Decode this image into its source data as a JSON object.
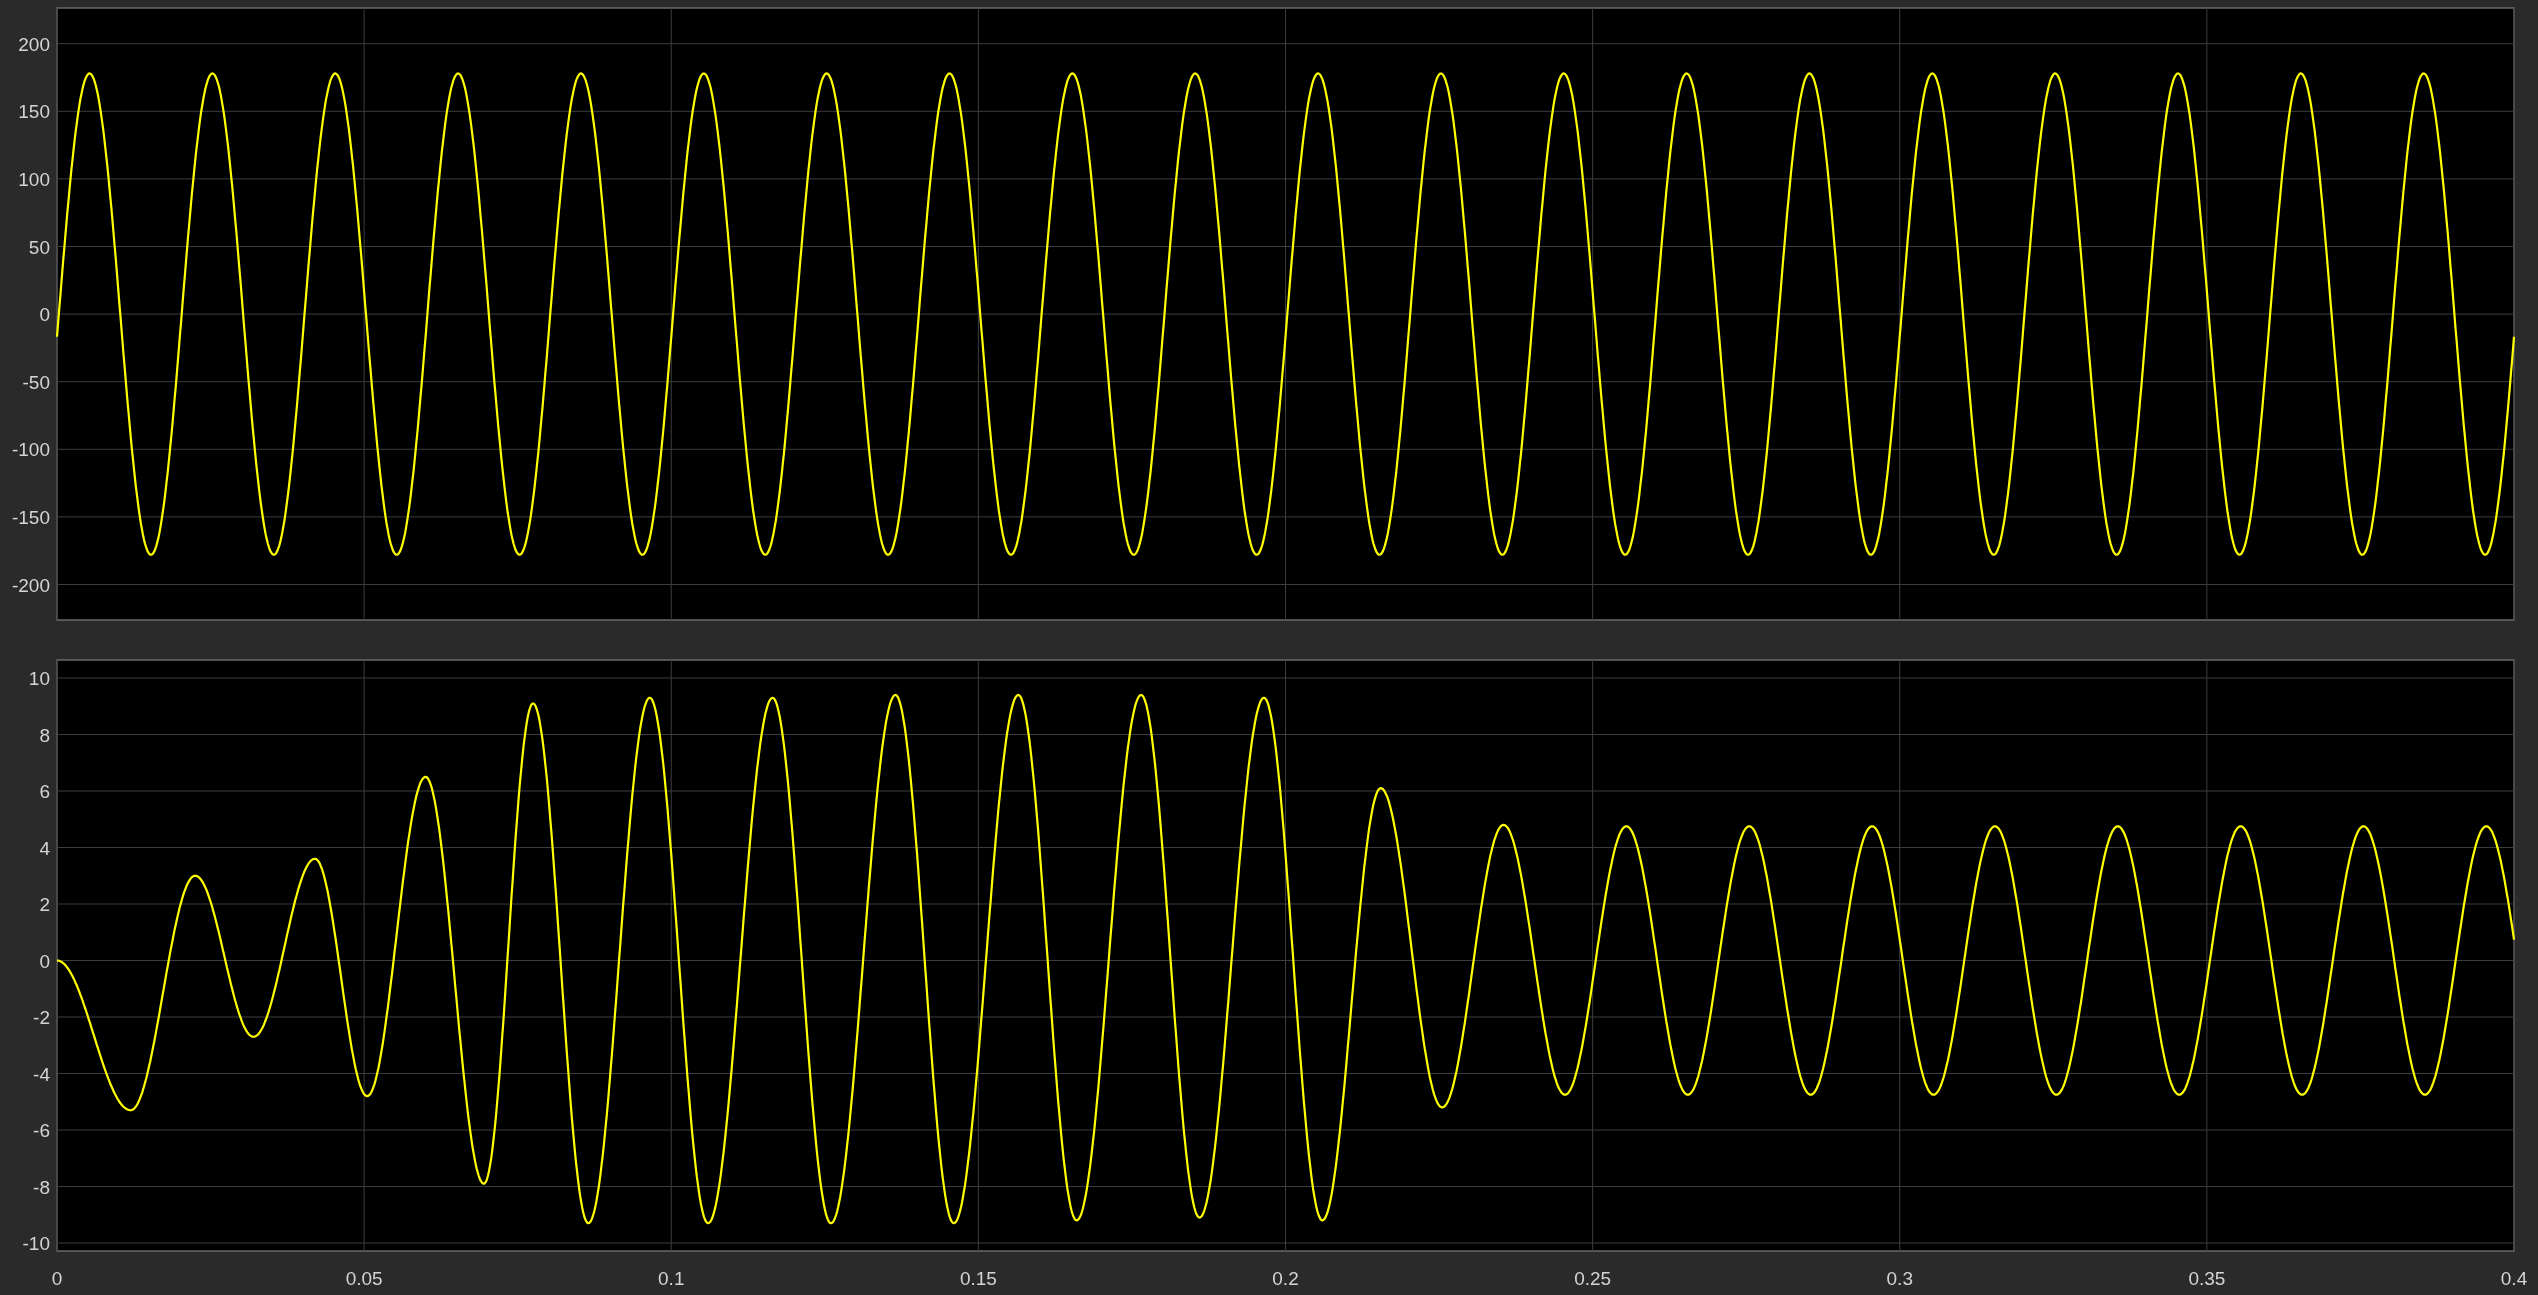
{
  "plots": [
    {
      "yticks": [
        "200",
        "150",
        "100",
        "50",
        "0",
        "-50",
        "-100",
        "-150",
        "-200"
      ]
    },
    {
      "yticks": [
        "10",
        "8",
        "6",
        "4",
        "2",
        "0",
        "-2",
        "-4",
        "-6",
        "-8",
        "-10"
      ]
    }
  ],
  "x_axis": {
    "ticks": [
      "0",
      "0.05",
      "0.1",
      "0.15",
      "0.2",
      "0.25",
      "0.3",
      "0.35",
      "0.4"
    ]
  }
}
